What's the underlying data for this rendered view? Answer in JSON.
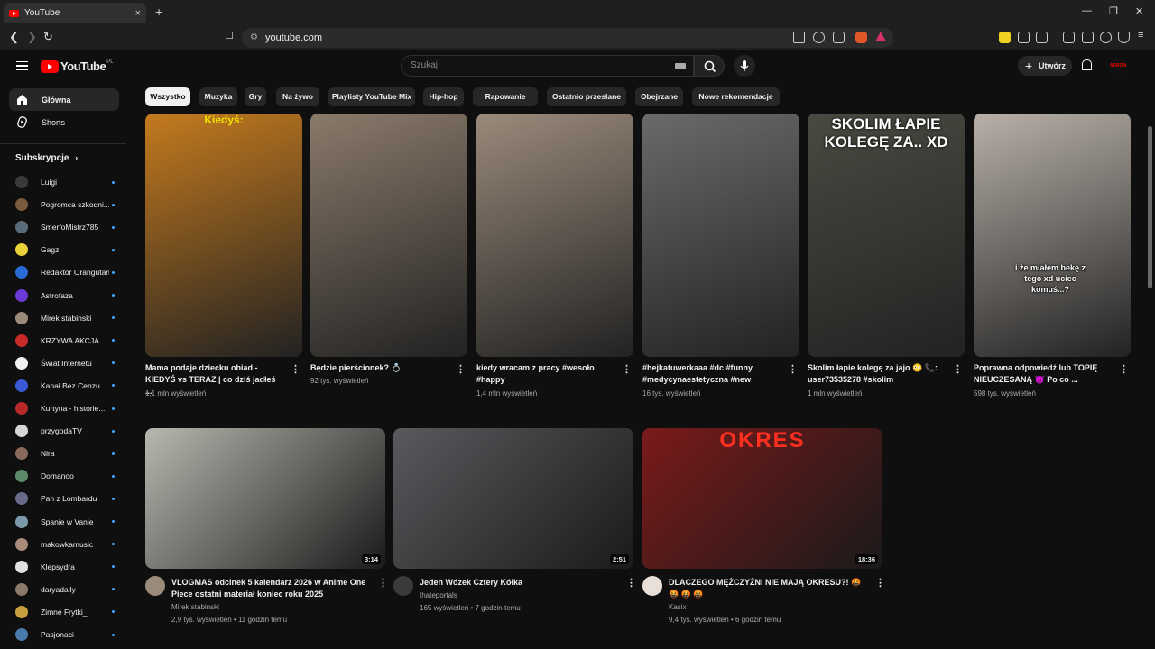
{
  "browser": {
    "tab_title": "YouTube",
    "tab_close": "×",
    "new_tab": "+",
    "url": "youtube.com",
    "window_controls": [
      "—",
      "❐",
      "✕"
    ]
  },
  "header": {
    "logo_text": "YouTube",
    "logo_region": "PL",
    "search_placeholder": "Szukaj",
    "create_label": "Utwórz",
    "create_plus": "+",
    "avatar_text": "ADRON"
  },
  "sidebar": {
    "nav": [
      {
        "label": "Główna"
      },
      {
        "label": "Shorts"
      }
    ],
    "subscriptions_heading": "Subskrypcje",
    "subscriptions": [
      {
        "name": "Luigi",
        "color": "#3a3a3a"
      },
      {
        "name": "Pogromca szkodni...",
        "color": "#7a5a3c"
      },
      {
        "name": "SmerfoMistrz785",
        "color": "#5a6b7a"
      },
      {
        "name": "Gagz",
        "color": "#e8d23a"
      },
      {
        "name": "Redaktor Orangutan",
        "color": "#2a6bd6"
      },
      {
        "name": "Astrofaza",
        "color": "#6b3ad6"
      },
      {
        "name": "Mirek stabinski",
        "color": "#9a8a7a"
      },
      {
        "name": "KRZYWA AKCJA",
        "color": "#c82a2a"
      },
      {
        "name": "Świat Internetu",
        "color": "#f0f0f0"
      },
      {
        "name": "Kanał Bez Cenzu...",
        "color": "#3a5ad6"
      },
      {
        "name": "Kurtyna - historie...",
        "color": "#b82a2a"
      },
      {
        "name": "przygodaTV",
        "color": "#d6d6d6"
      },
      {
        "name": "Nira",
        "color": "#8a6a5a"
      },
      {
        "name": "Domanoo",
        "color": "#5a8a6a"
      },
      {
        "name": "Pan z Lombardu",
        "color": "#6a6a8a"
      },
      {
        "name": "Spanie w Vanie",
        "color": "#7a9aaa"
      },
      {
        "name": "makowkamusic",
        "color": "#aa8a7a"
      },
      {
        "name": "Klepsydra",
        "color": "#e0e0e0"
      },
      {
        "name": "daryadaily",
        "color": "#8a7a6a"
      },
      {
        "name": "Zimne Frytki_",
        "color": "#c8a040"
      },
      {
        "name": "Pasjonaci",
        "color": "#4a7aaa"
      }
    ]
  },
  "chips": [
    "Wszystko",
    "Muzyka",
    "Gry",
    "Na żywo",
    "Playlisty YouTube Mix",
    "Hip-hop",
    "Rapowanie",
    "Ostatnio przesłane",
    "Obejrzane",
    "Nowe rekomendacje"
  ],
  "shorts": [
    {
      "title": "Mama podaje dziecku obiad - KIEDYŚ vs TERAZ | co dziś jadłeś ...",
      "views": "1,1 mln wyświetleń",
      "overlay": "Kiedyś:",
      "color": "#c47a1e"
    },
    {
      "title": "Będzie pierścionek? 💍",
      "views": "92 tys. wyświetleń",
      "overlay": "",
      "color": "#8a7a6a"
    },
    {
      "title": "kiedy wracam z pracy #wesoło #happy",
      "views": "1,4 mln wyświetleń",
      "overlay": "",
      "color": "#9a8a7a"
    },
    {
      "title": "#hejkatuwerkaaa #dc #funny #medycynaestetyczna #new",
      "views": "16 tys. wyświetleń",
      "overlay": "",
      "color": "#6a6a6a"
    },
    {
      "title": "Skolim łapie kolegę za jajo 😳 📞: user73535278 #skolim",
      "views": "1 mln wyświetleń",
      "overlay": "SKOLIM ŁAPIE KOLEGĘ ZA.. XD",
      "color": "#4a4a42"
    },
    {
      "title": "Poprawna odpowiedź lub TOPIĘ NIEUCZESANĄ 😈 Po co ...",
      "views": "598 tys. wyświetleń",
      "overlay": "i że miałem bekę z tego xd uciec komuś...?",
      "color": "#b8b0a8"
    }
  ],
  "videos": [
    {
      "title": "VLOGMAS odcinek 5 kalendarz 2026 w Anime One Piece ostatni materiał koniec roku 2025",
      "channel": "Mirek stabinski",
      "meta": "2,9 tys. wyświetleń • 11 godzin temu",
      "duration": "3:14",
      "color": "#b8b8b0",
      "avatar": "#9a8a7a"
    },
    {
      "title": "Jeden Wózek Cztery Kółka",
      "channel": "Ihateportals",
      "meta": "165 wyświetleń • 7 godzin temu",
      "duration": "2:51",
      "color": "#5a5a5e",
      "avatar": "#3a3a3a"
    },
    {
      "title": "DLACZEGO MĘŻCZYŹNI NIE MAJĄ OKRESU?! 🤬 🤬 🤬 🤬",
      "channel": "Kasix",
      "meta": "9,4 tys. wyświetleń • 6 godzin temu",
      "duration": "18:36",
      "color": "#7a1a1a",
      "avatar": "#e8e0d8",
      "overlay": "OKRES"
    }
  ],
  "more_icon": "⋮",
  "colors": {
    "background": "#0f0f0f",
    "accent": "#ff0000",
    "chip_bg": "#272727"
  }
}
